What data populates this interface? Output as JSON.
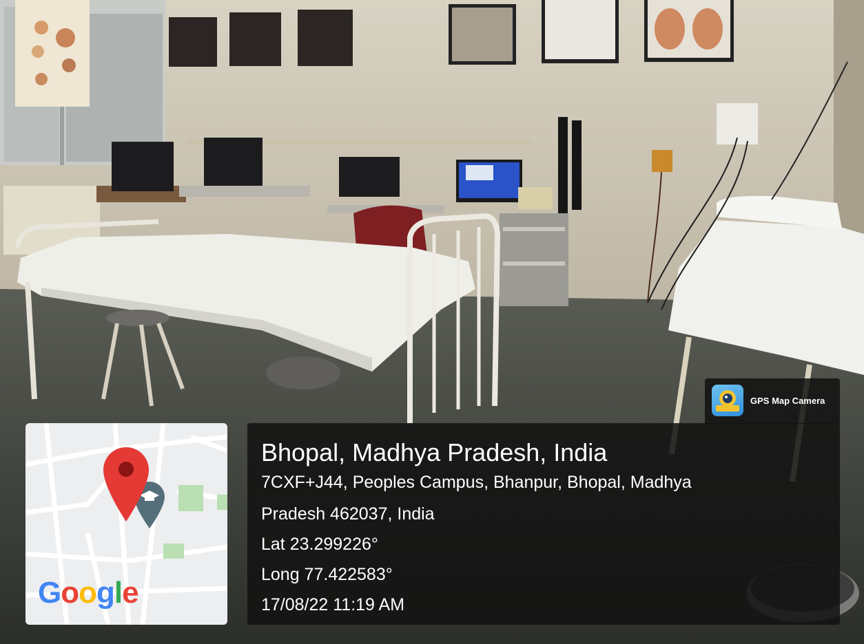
{
  "location": {
    "city": "Bhopal, Madhya Pradesh, India",
    "address_line1": "7CXF+J44, Peoples Campus, Bhanpur, Bhopal, Madhya",
    "address_line2": "Pradesh 462037, India",
    "latitude": "Lat 23.299226°",
    "longitude": "Long 77.422583°",
    "datetime": "17/08/22 11:19 AM"
  },
  "app_badge": {
    "label": "GPS Map Camera",
    "icon": "gps-camera-icon"
  },
  "map": {
    "logo": [
      "G",
      "o",
      "o",
      "g",
      "l",
      "e"
    ],
    "logo_colors": [
      "#4285F4",
      "#EA4335",
      "#FBBC05",
      "#4285F4",
      "#34A853",
      "#EA4335"
    ],
    "pin_color": "#E53935",
    "school_pin_color": "#546E7A"
  }
}
